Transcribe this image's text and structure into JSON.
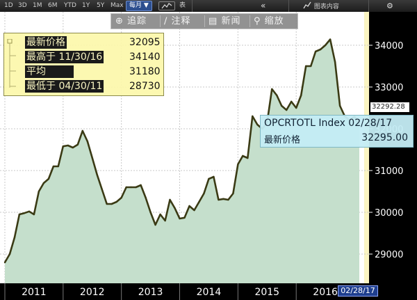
{
  "toolbar": {
    "ranges": [
      "1D",
      "3D",
      "1M",
      "6M",
      "YTD",
      "1Y",
      "5Y",
      "Max"
    ],
    "period_select": "每月 ▼",
    "table_label": "表",
    "collapse_icon": "double-chevron-left",
    "chart_content_label": "图表内容",
    "settings_icon": "gear"
  },
  "controls": {
    "track": "追踪",
    "annotate": "注释",
    "news": "新闻",
    "zoom": "缩放"
  },
  "legend": {
    "rows": [
      {
        "label": "最新价格",
        "value": "32095"
      },
      {
        "label": "最高于 11/30/16",
        "value": "34140"
      },
      {
        "label": "平均",
        "value": "31180"
      },
      {
        "label": "最低于 04/30/11",
        "value": "28730"
      }
    ]
  },
  "tooltip": {
    "title": "OPCRTOTL Index 02/28/17",
    "label": "最新价格",
    "value": "32295.00"
  },
  "last_price_tag": "32292.28",
  "date_tag": "02/28/17",
  "colors": {
    "line": "#3a3a14",
    "area": "#c5dfcc",
    "plot_bg": "#ffffff",
    "future_bg": "#fbf5c2",
    "axis_bg": "#000000",
    "text": "#ffffff"
  },
  "chart_data": {
    "type": "area",
    "ylim": [
      28300,
      34800
    ],
    "yticks": [
      29000,
      30000,
      31000,
      32000,
      33000,
      34000
    ],
    "xticks": [
      "2011",
      "2012",
      "2013",
      "2014",
      "2015",
      "2016"
    ],
    "x_start": "2010-12",
    "x_end": "2017-04",
    "highlight_from": "2017-03",
    "grid": true,
    "series": [
      {
        "name": "OPCRTOTL Index",
        "x": [
          "2011-01",
          "2011-02",
          "2011-03",
          "2011-04",
          "2011-05",
          "2011-06",
          "2011-07",
          "2011-08",
          "2011-09",
          "2011-10",
          "2011-11",
          "2011-12",
          "2012-01",
          "2012-02",
          "2012-03",
          "2012-04",
          "2012-05",
          "2012-06",
          "2012-07",
          "2012-08",
          "2012-09",
          "2012-10",
          "2012-11",
          "2012-12",
          "2013-01",
          "2013-02",
          "2013-03",
          "2013-04",
          "2013-05",
          "2013-06",
          "2013-07",
          "2013-08",
          "2013-09",
          "2013-10",
          "2013-11",
          "2013-12",
          "2014-01",
          "2014-02",
          "2014-03",
          "2014-04",
          "2014-05",
          "2014-06",
          "2014-07",
          "2014-08",
          "2014-09",
          "2014-10",
          "2014-11",
          "2014-12",
          "2015-01",
          "2015-02",
          "2015-03",
          "2015-04",
          "2015-05",
          "2015-06",
          "2015-07",
          "2015-08",
          "2015-09",
          "2015-10",
          "2015-11",
          "2015-12",
          "2016-01",
          "2016-02",
          "2016-03",
          "2016-04",
          "2016-05",
          "2016-06",
          "2016-07",
          "2016-08",
          "2016-09",
          "2016-10",
          "2016-11",
          "2016-12",
          "2017-01",
          "2017-02"
        ],
        "values": [
          28800,
          29000,
          29400,
          29950,
          29980,
          30020,
          29950,
          30500,
          30700,
          30800,
          31100,
          31100,
          31580,
          31600,
          31550,
          31620,
          31950,
          31700,
          31300,
          30900,
          30550,
          30200,
          30200,
          30250,
          30350,
          30600,
          30600,
          30600,
          30650,
          30350,
          30000,
          29700,
          29950,
          29800,
          30300,
          30100,
          29850,
          29870,
          30150,
          30050,
          30250,
          30450,
          30800,
          30850,
          30300,
          30320,
          30300,
          30450,
          31150,
          31350,
          31300,
          32300,
          32100,
          32000,
          32150,
          32950,
          32800,
          32550,
          32450,
          32650,
          32500,
          32800,
          33500,
          33500,
          33850,
          33900,
          34000,
          34140,
          33600,
          32550,
          32300,
          32200,
          32295,
          32095
        ]
      }
    ]
  }
}
